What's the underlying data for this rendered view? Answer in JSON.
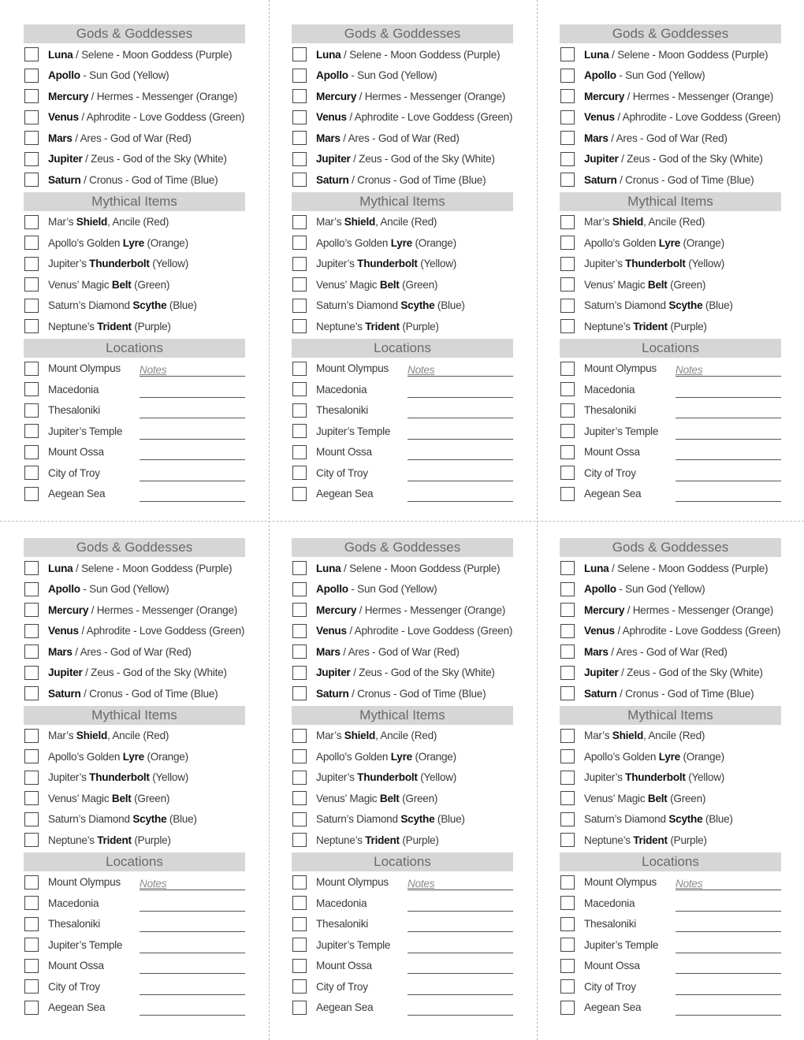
{
  "sections": [
    {
      "title": "Gods & Goddesses",
      "type": "check",
      "items": [
        [
          {
            "t": "Luna",
            "b": true
          },
          {
            "t": " / Selene - Moon Goddess (Purple)"
          }
        ],
        [
          {
            "t": "Apollo",
            "b": true
          },
          {
            "t": " - Sun God (Yellow)"
          }
        ],
        [
          {
            "t": "Mercury",
            "b": true
          },
          {
            "t": " / Hermes - Messenger (Orange)"
          }
        ],
        [
          {
            "t": "Venus",
            "b": true
          },
          {
            "t": " / Aphrodite - Love Goddess (Green)"
          }
        ],
        [
          {
            "t": "Mars",
            "b": true
          },
          {
            "t": " / Ares - God of War (Red)"
          }
        ],
        [
          {
            "t": "Jupiter",
            "b": true
          },
          {
            "t": " / Zeus - God of the Sky (White)"
          }
        ],
        [
          {
            "t": "Saturn",
            "b": true
          },
          {
            "t": " / Cronus - God of Time (Blue)"
          }
        ]
      ]
    },
    {
      "title": "Mythical Items",
      "type": "check",
      "items": [
        [
          {
            "t": "Mar’s "
          },
          {
            "t": "Shield",
            "b": true
          },
          {
            "t": ", Ancile (Red)"
          }
        ],
        [
          {
            "t": "Apollo’s Golden "
          },
          {
            "t": "Lyre",
            "b": true
          },
          {
            "t": " (Orange)"
          }
        ],
        [
          {
            "t": "Jupiter’s "
          },
          {
            "t": "Thunderbolt",
            "b": true
          },
          {
            "t": " (Yellow)"
          }
        ],
        [
          {
            "t": "Venus’ Magic "
          },
          {
            "t": "Belt",
            "b": true
          },
          {
            "t": " (Green)"
          }
        ],
        [
          {
            "t": "Saturn’s Diamond "
          },
          {
            "t": "Scythe",
            "b": true
          },
          {
            "t": " (Blue)"
          }
        ],
        [
          {
            "t": "Neptune’s "
          },
          {
            "t": "Trident",
            "b": true
          },
          {
            "t": " (Purple)"
          }
        ]
      ]
    },
    {
      "title": "Locations",
      "type": "notes",
      "notes_label": "Notes",
      "items": [
        [
          {
            "t": "Mount Olympus"
          }
        ],
        [
          {
            "t": "Macedonia"
          }
        ],
        [
          {
            "t": "Thesaloniki"
          }
        ],
        [
          {
            "t": "Jupiter’s Temple"
          }
        ],
        [
          {
            "t": "Mount Ossa"
          }
        ],
        [
          {
            "t": "City of Troy"
          }
        ],
        [
          {
            "t": "Aegean Sea"
          }
        ]
      ]
    }
  ]
}
